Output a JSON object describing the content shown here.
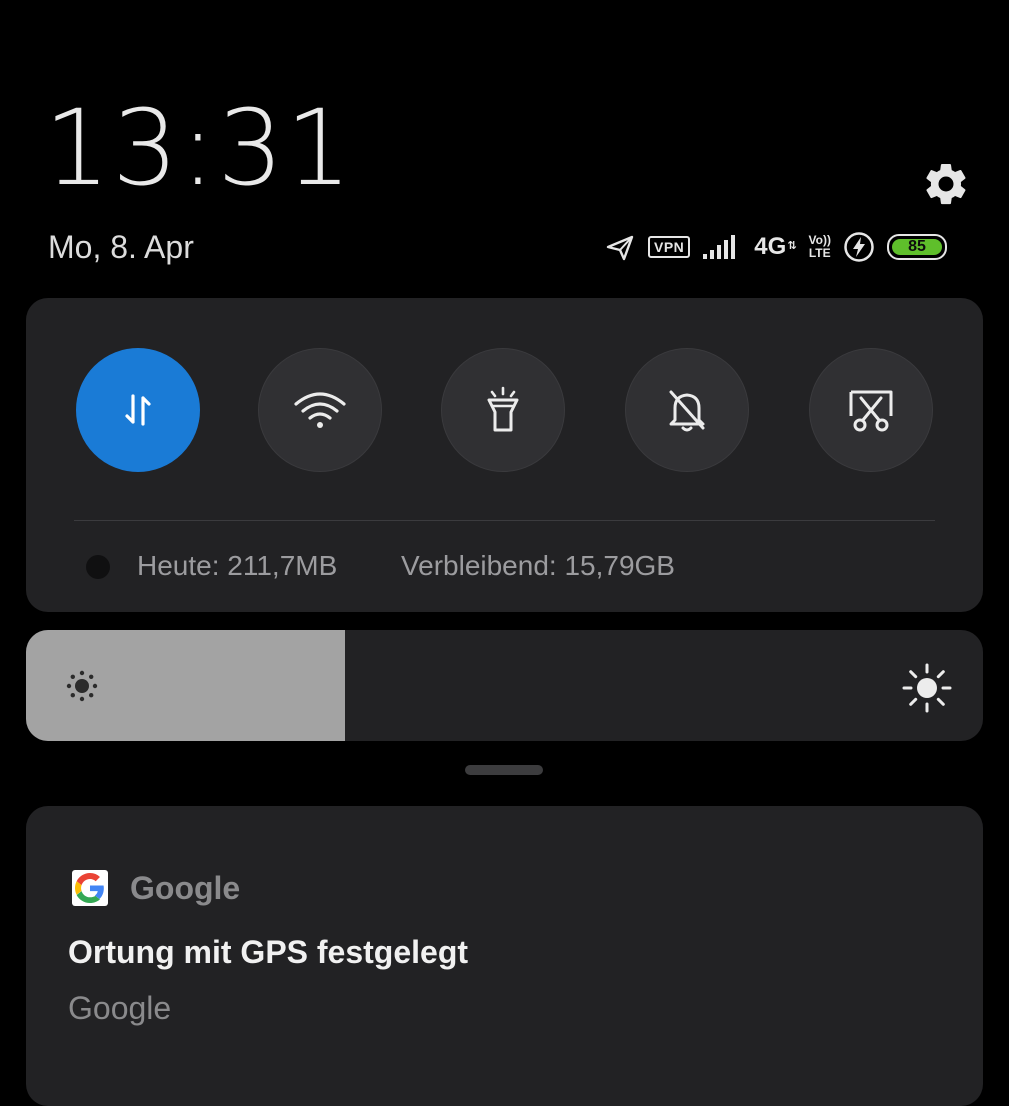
{
  "header": {
    "time": "13:31",
    "date": "Mo, 8. Apr"
  },
  "status_bar": {
    "icons": [
      "location-arrow-icon",
      "vpn-icon",
      "signal-icon",
      "4g-icon",
      "volte-icon",
      "charging-icon",
      "battery-icon"
    ],
    "vpn_label": "VPN",
    "network_label": "4G",
    "volte_top": "Vo))",
    "volte_bottom": "LTE",
    "battery_level": "85",
    "battery_color": "#5fbf2b"
  },
  "quick_settings": {
    "toggles": [
      {
        "name": "mobile-data",
        "icon": "data-arrows-icon",
        "on": true
      },
      {
        "name": "wifi",
        "icon": "wifi-icon",
        "on": false
      },
      {
        "name": "flashlight",
        "icon": "flashlight-icon",
        "on": false
      },
      {
        "name": "mute",
        "icon": "bell-off-icon",
        "on": false
      },
      {
        "name": "screenshot",
        "icon": "scissors-icon",
        "on": false
      }
    ],
    "accent_color": "#1a7bd6",
    "data_usage": {
      "today": "Heute: 211,7MB",
      "remaining": "Verbleibend: 15,79GB"
    }
  },
  "brightness": {
    "level": 0.333
  },
  "notification": {
    "app_name": "Google",
    "title": "Ortung mit GPS festgelegt",
    "body": "Google"
  }
}
